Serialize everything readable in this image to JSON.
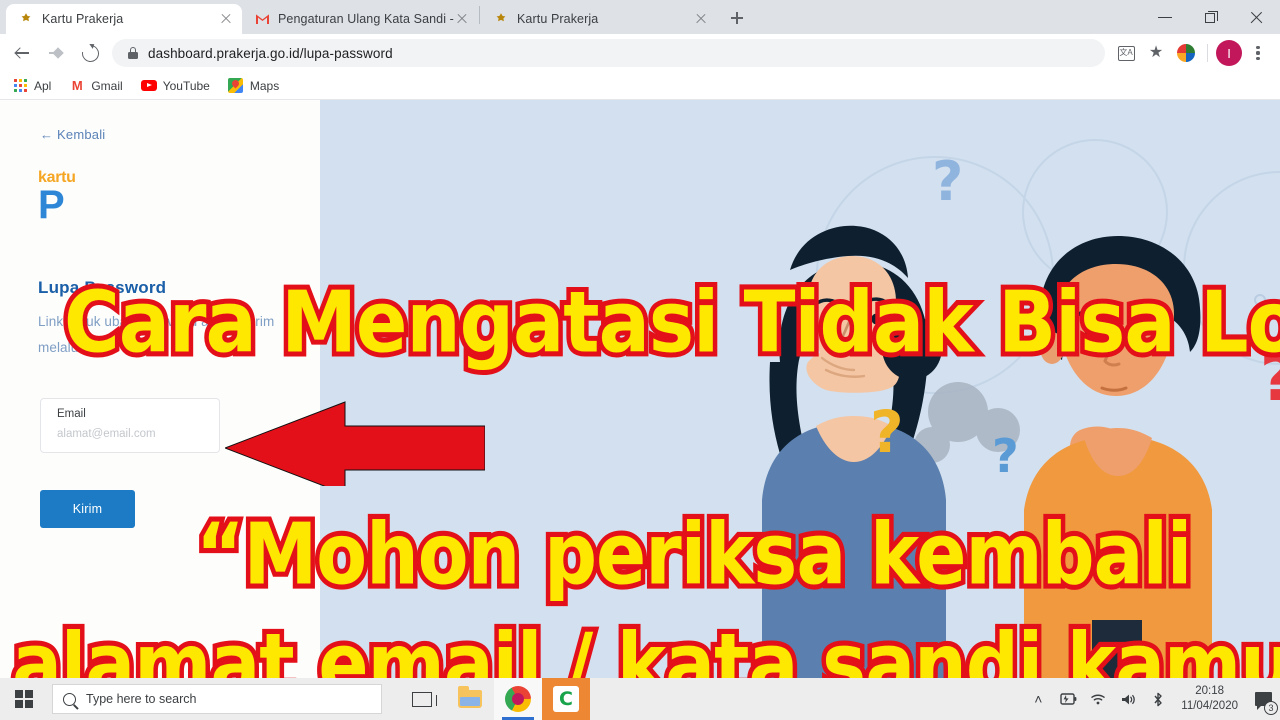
{
  "browser": {
    "tabs": [
      {
        "title": "Kartu Prakerja",
        "favicon": "garuda-icon",
        "active": true
      },
      {
        "title": "Pengaturan Ulang Kata Sandi - h",
        "favicon": "gmail-icon",
        "active": false
      },
      {
        "title": "Kartu Prakerja",
        "favicon": "garuda-icon",
        "active": false
      }
    ],
    "new_tab_label": "+",
    "window_controls": {
      "minimize": "minimize-icon",
      "maximize": "restore-icon",
      "close": "close-icon"
    },
    "toolbar": {
      "back": "back-arrow-icon",
      "forward": "forward-arrow-icon",
      "reload": "reload-icon",
      "lock": "lock-icon",
      "url": "dashboard.prakerja.go.id/lupa-password",
      "translate": "translate-icon",
      "translate_glyph": "文A",
      "bookmark_star": "★",
      "extension": "extension-icon",
      "avatar_initial": "I",
      "menu": "kebab-menu-icon"
    },
    "bookmarks": [
      {
        "label": "Apl",
        "icon": "apps-grid-icon"
      },
      {
        "label": "Gmail",
        "icon": "gmail-icon"
      },
      {
        "label": "YouTube",
        "icon": "youtube-icon"
      },
      {
        "label": "Maps",
        "icon": "maps-icon"
      }
    ]
  },
  "page": {
    "back_link": "← Kembali",
    "brand": {
      "kartu": "kartu",
      "p": "P"
    },
    "title": "Lupa Password",
    "description": "Link untuk ubah password akan dikirim melalui email",
    "email_field": {
      "label": "Email",
      "placeholder": "alamat@email.com",
      "value": ""
    },
    "submit_button": "Kirim",
    "illustration": "confused-couple-illustration"
  },
  "annotations": {
    "arrow": "red-left-arrow",
    "line1": "Cara Mengatasi Tidak Bisa Login",
    "line2": "“Mohon periksa kembali",
    "line3": "alamat email / kata sandi kamu.”",
    "fill_color": "#ffe800",
    "stroke_color": "#e3101a"
  },
  "taskbar": {
    "start": "windows-logo-icon",
    "search_placeholder": "Type here to search",
    "search_icon": "search-icon",
    "apps": [
      {
        "name": "task-view-icon",
        "label": ""
      },
      {
        "name": "file-explorer-icon",
        "label": ""
      },
      {
        "name": "chrome-icon",
        "label": ""
      },
      {
        "name": "camtasia-icon",
        "label": "C"
      }
    ],
    "tray": {
      "chevron": "˄",
      "battery": "battery-charging-icon",
      "wifi": "wifi-icon",
      "volume": "volume-icon",
      "bluetooth": "bluetooth-icon",
      "time": "20:18",
      "date": "11/04/2020",
      "notification_count": "3"
    }
  },
  "colors": {
    "brand_blue": "#1a5fa8",
    "accent_orange": "#f5a623",
    "page_blue_bg": "#d3e0ef",
    "button_blue": "#1c7bc4"
  }
}
